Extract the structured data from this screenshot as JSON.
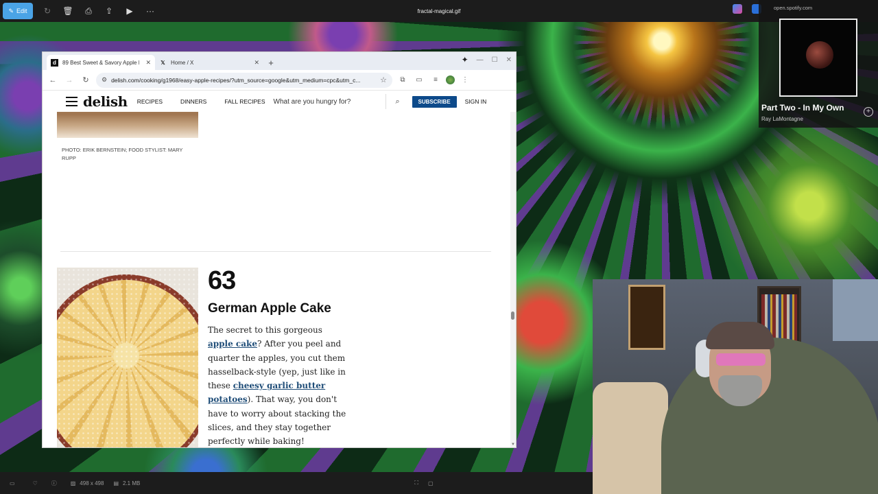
{
  "viewer": {
    "edit_label": "Edit",
    "file_title": "fractal-magical.gif",
    "dimensions": "498 x 498",
    "file_size": "2.1 MB"
  },
  "browser": {
    "tabs": [
      {
        "label": "89 Best Sweet & Savory Apple R",
        "active": true
      },
      {
        "label": "Home / X",
        "active": false
      }
    ],
    "url": "delish.com/cooking/g1968/easy-apple-recipes/?utm_source=google&utm_medium=cpc&utm_c..."
  },
  "site": {
    "logo": "delish",
    "nav": [
      "RECIPES",
      "DINNERS",
      "FALL RECIPES"
    ],
    "search_placeholder": "What are you hungry for?",
    "subscribe": "SUBSCRIBE",
    "signin": "SIGN IN"
  },
  "content": {
    "photo_credit": "PHOTO: ERIK BERNSTEIN; FOOD STYLIST: MARY RUPP",
    "recipe_number": "63",
    "recipe_title": "German Apple Cake",
    "text": {
      "t1": "The secret to this gorgeous ",
      "l1": "apple cake",
      "t2": "? After you peel and quarter the apples, you cut them hasselback-style (yep, just like in these ",
      "l2": "cheesy garlic butter potatoes",
      "t3": "). That way, you don't have to worry about stacking the slices, and they stay together perfectly while baking!"
    }
  },
  "spotify": {
    "host": "open.spotify.com",
    "track": "Part Two - In My Own",
    "artist": "Ray LaMontagne"
  }
}
